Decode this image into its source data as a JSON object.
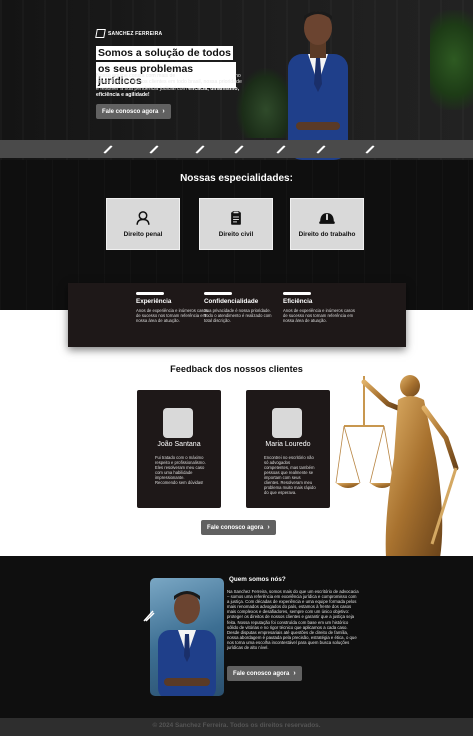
{
  "hero": {
    "logo_text": "SANCHEZ FERREIRA",
    "title_line1": "Somos a solução de todos",
    "title_line2": "os seus problemas jurídicos",
    "desc_1": "Nossa equipe consta com mais de ",
    "desc_bold1": "30 anos de experiência",
    "desc_2": " no mercado e atendemos clientes em todo brasil, nossa prioridade é resolver a sua pendencia judicial com ",
    "desc_bold2": "eficácia, dinamismo, eficiência e agilidade!",
    "cta": "Fale conosco agora"
  },
  "strip": {
    "icon": "checkmark-icon",
    "count": 7
  },
  "specialties": {
    "title": "Nossas especialidades:",
    "items": [
      {
        "label": "Direito penal",
        "icon": "user-icon"
      },
      {
        "label": "Direito civil",
        "icon": "clipboard-icon"
      },
      {
        "label": "Direito do trabalho",
        "icon": "hardhat-icon"
      }
    ]
  },
  "values": [
    {
      "title": "Experiência",
      "desc": "Anos de experiência e inúmeros casos de sucesso nos tornam referência em nossa área de atuação."
    },
    {
      "title": "Confidencialidade",
      "desc": "Sua privacidade é nossa prioridade. Todo o atendimento é realizado com total discrição."
    },
    {
      "title": "Eficiência",
      "desc": "Anos de experiência e inúmeros casos de sucesso nos tornam referência em nossa área de atuação."
    }
  ],
  "feedback": {
    "title": "Feedback dos nossos clientes",
    "items": [
      {
        "name": "João Santana",
        "text": "Fui tratado com o máximo respeito e profissionalismo. Eles resolveram meu caso com uma habilidade impressionante. Recomendo sem dúvidas!"
      },
      {
        "name": "Maria Louredo",
        "text": "Encontrei no escritório não só advogados competentes, mas também pessoas que realmente se importam com seus clientes. Resolveram meu problema muito mais rápido do que esperava."
      }
    ],
    "cta": "Fale conosco agora"
  },
  "about": {
    "title": "Quem somos nós?",
    "text": "Na Sanchez Ferreira, somos mais do que um escritório de advocacia – somos uma referência em excelência jurídica e compromisso com a justiça. Com décadas de experiência e uma equipe formada pelos mais renomados advogados do país, estamos à frente dos casos mais complexos e desafiadores, sempre com um único objetivo: proteger os direitos de nossos clientes e garantir que a justiça seja feita. Nossa reputação foi construída com base em um histórico sólido de vitórias e no rigor técnico que aplicamos a cada caso. Desde disputas empresariais até questões de direito de família, nossa abordagem é pautada pela precisão, estratégia e ética, o que nos torna uma escolha incontestável para quem busca soluções jurídicas de alto nível.",
    "cta": "Fale conosco agora"
  },
  "footer": {
    "text": "© 2024 Sanchez Ferreira. Todos os direitos reservados."
  },
  "colors": {
    "dark": "#0f0f0f",
    "card_dark": "#1e1818",
    "button": "#616161",
    "card_light": "#d9d9d9"
  }
}
